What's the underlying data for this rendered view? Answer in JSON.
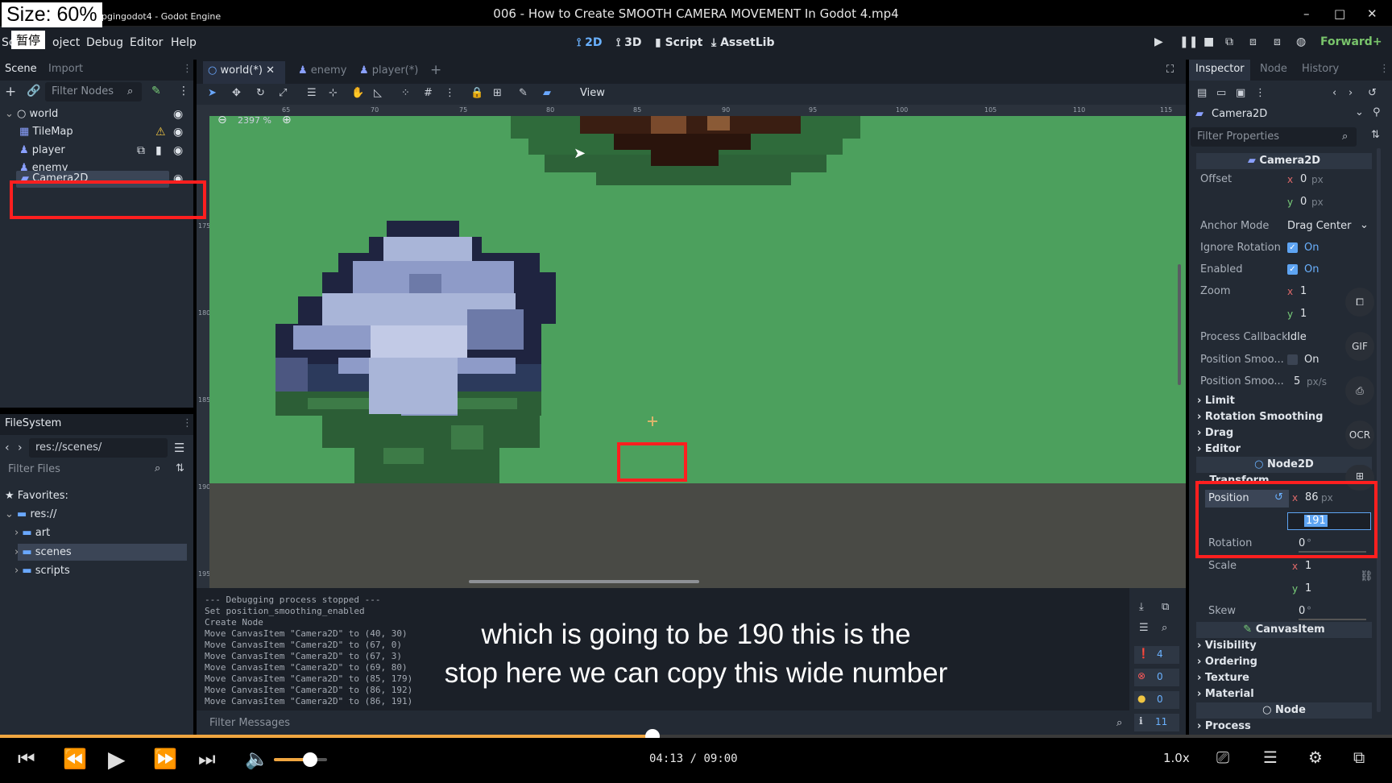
{
  "video": {
    "title": "006 - How to Create SMOOTH CAMERA MOVEMENT In Godot 4.mp4",
    "size_badge": "Size: 60%",
    "pause_badge": "暂停",
    "time_current": "04:13",
    "time_sep": "/",
    "time_total": "09:00",
    "speed": "1.0x",
    "progress": 0.469,
    "volume": 0.68,
    "side_buttons": [
      "GIF",
      "OCR"
    ]
  },
  "window": {
    "title_fragment": "pgingodot4 - Godot Engine",
    "min": "–",
    "max": "□",
    "close": "✕"
  },
  "menu": {
    "items": [
      "Sc",
      "oject",
      "Debug",
      "Editor",
      "Help"
    ],
    "workspaces": [
      "2D",
      "3D",
      "Script",
      "AssetLib"
    ],
    "renderer": "Forward+"
  },
  "scene_dock": {
    "tabs": [
      "Scene",
      "Import"
    ],
    "filter_placeholder": "Filter Nodes",
    "nodes": [
      "world",
      "TileMap",
      "player",
      "enemy",
      "Camera2D"
    ]
  },
  "filesystem": {
    "title": "FileSystem",
    "path": "res://scenes/",
    "filter_placeholder": "Filter Files",
    "favorites": "Favorites:",
    "root": "res://",
    "folders": [
      "art",
      "scenes",
      "scripts"
    ]
  },
  "editor": {
    "tabs": [
      "world(*)",
      "enemy",
      "player(*)"
    ],
    "zoom": "2397 %",
    "view_menu": "View",
    "ruler_ticks": [
      "65",
      "70",
      "75",
      "80",
      "85",
      "90",
      "95",
      "100",
      "105",
      "110",
      "115"
    ],
    "vruler_ticks": [
      "175",
      "180",
      "185",
      "190",
      "195"
    ]
  },
  "output": {
    "lines": [
      "--- Debugging process stopped ---",
      "Set position_smoothing_enabled",
      "Create Node",
      "Move CanvasItem \"Camera2D\" to (40, 30)",
      "Move CanvasItem \"Camera2D\" to (67, 0)",
      "Move CanvasItem \"Camera2D\" to (67, 3)",
      "Move CanvasItem \"Camera2D\" to (69, 80)",
      "Move CanvasItem \"Camera2D\" to (85, 179)",
      "Move CanvasItem \"Camera2D\" to (86, 192)",
      "Move CanvasItem \"Camera2D\" to (86, 191)"
    ],
    "filter_placeholder": "Filter Messages",
    "counts": [
      "4",
      "0",
      "0",
      "11"
    ]
  },
  "subtitles": [
    "which is going to be 190 this is the",
    "stop here we can copy this wide number"
  ],
  "inspector": {
    "tabs": [
      "Inspector",
      "Node",
      "History"
    ],
    "node_name": "Camera2D",
    "filter_placeholder": "Filter Properties",
    "class_header": "Camera2D",
    "offset_label": "Offset",
    "offset_x": "0",
    "offset_y": "0",
    "unit_px": "px",
    "anchor_label": "Anchor Mode",
    "anchor_value": "Drag Center",
    "ignore_rotation_label": "Ignore Rotation",
    "enabled_label": "Enabled",
    "on_label": "On",
    "zoom_label": "Zoom",
    "zoom_x": "1",
    "zoom_y": "1",
    "process_cb_label": "Process Callback",
    "process_cb_value": "Idle",
    "pos_smooth_label": "Position Smoo...",
    "pos_smooth_speed_label": "Position Smoo...",
    "pos_smooth_speed": "5",
    "unit_pxs": "px/s",
    "sections": [
      "Limit",
      "Rotation Smoothing",
      "Drag",
      "Editor"
    ],
    "node2d_header": "Node2D",
    "transform_label": "Transform",
    "position_label": "Position",
    "position_x": "86",
    "position_y": "191",
    "rotation_label": "Rotation",
    "rotation_value": "0",
    "deg": "°",
    "scale_label": "Scale",
    "scale_x": "1",
    "scale_y": "1",
    "skew_label": "Skew",
    "skew_value": "0",
    "canvasitem_header": "CanvasItem",
    "ci_sections": [
      "Visibility",
      "Ordering",
      "Texture",
      "Material"
    ],
    "node_header": "Node",
    "node_sections": [
      "Process"
    ],
    "axis_x": "x",
    "axis_y": "y"
  },
  "colors": {
    "accent": "#5ea4f2",
    "grass": "#4ca05d",
    "ground": "#494a45",
    "progress": "#f0a640",
    "highlight_red": "#ff1f1f"
  }
}
